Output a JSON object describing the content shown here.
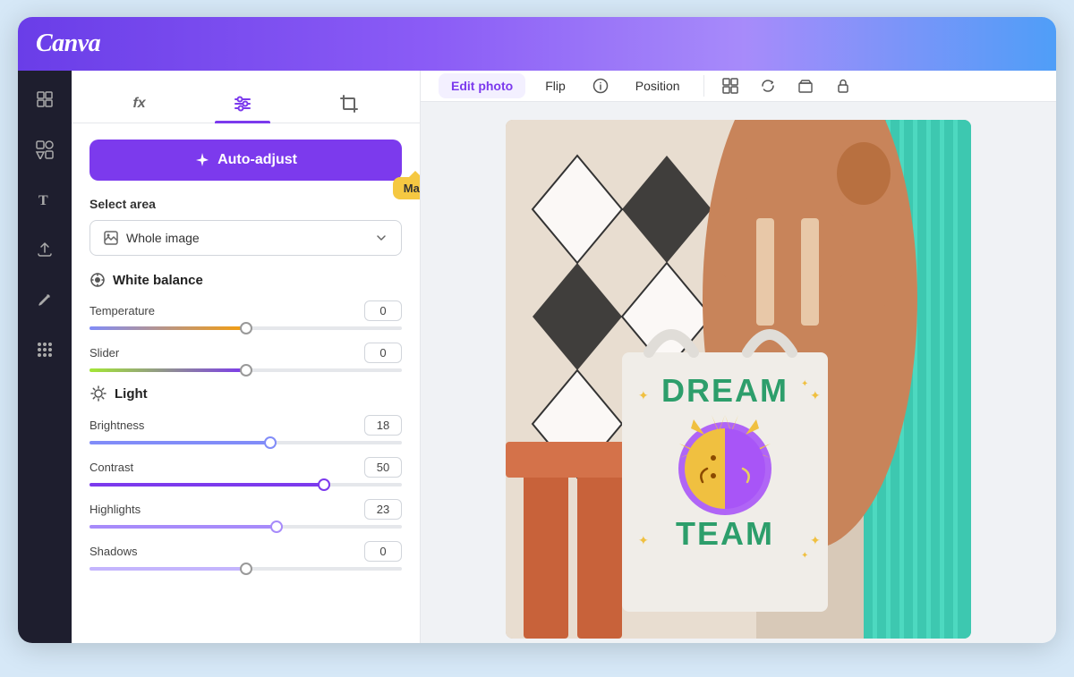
{
  "app": {
    "logo": "Canva"
  },
  "sidebar": {
    "icons": [
      {
        "name": "layout-icon",
        "glyph": "⊞",
        "label": "Layout"
      },
      {
        "name": "elements-icon",
        "glyph": "✦",
        "label": "Elements"
      },
      {
        "name": "text-icon",
        "glyph": "T",
        "label": "Text"
      },
      {
        "name": "upload-icon",
        "glyph": "☁",
        "label": "Upload"
      },
      {
        "name": "draw-icon",
        "glyph": "✏",
        "label": "Draw"
      },
      {
        "name": "apps-icon",
        "glyph": "⋯",
        "label": "Apps"
      }
    ]
  },
  "panel": {
    "tabs": [
      {
        "name": "effects-tab",
        "label": "fx",
        "active": false
      },
      {
        "name": "adjustments-tab",
        "label": "⚙",
        "active": true
      },
      {
        "name": "crop-tab",
        "label": "⬜",
        "active": false
      }
    ],
    "auto_adjust_label": "Auto-adjust",
    "select_area_label": "Select area",
    "select_area_value": "Whole image",
    "tooltip": "Martina",
    "white_balance": {
      "heading": "White balance",
      "temperature": {
        "label": "Temperature",
        "value": "0"
      },
      "slider": {
        "label": "Slider",
        "value": "0"
      }
    },
    "light": {
      "heading": "Light",
      "brightness": {
        "label": "Brightness",
        "value": "18"
      },
      "contrast": {
        "label": "Contrast",
        "value": "50"
      },
      "highlights": {
        "label": "Highlights",
        "value": "23"
      },
      "shadows": {
        "label": "Shadows",
        "value": "0"
      }
    }
  },
  "toolbar": {
    "edit_photo_label": "Edit photo",
    "flip_label": "Flip",
    "info_label": "ℹ",
    "position_label": "Position"
  }
}
